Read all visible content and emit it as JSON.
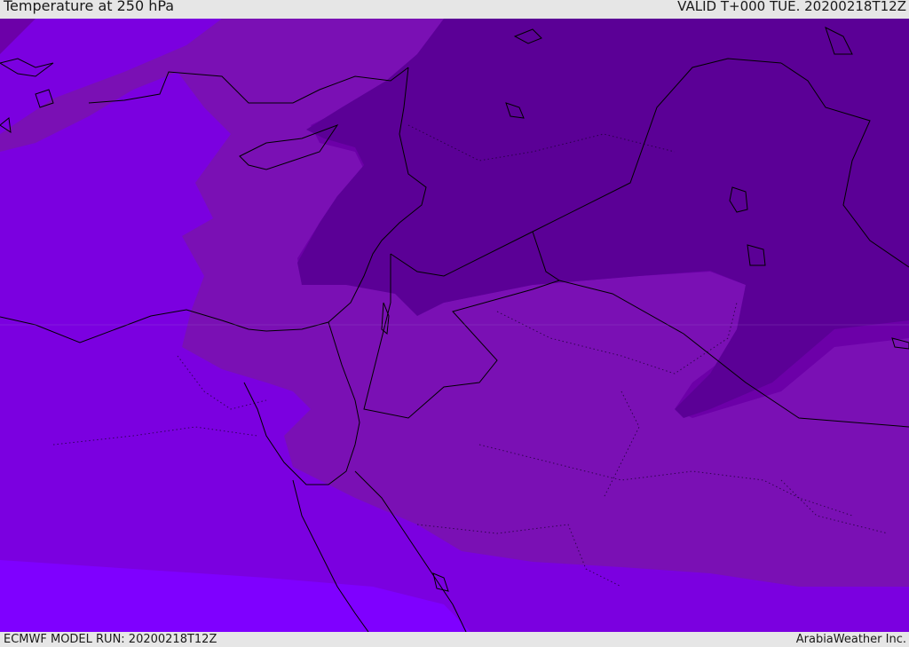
{
  "header": {
    "title": "Temperature at 250 hPa",
    "valid": "VALID T+000 TUE. 20200218T12Z"
  },
  "footer": {
    "model_run": "ECMWF MODEL RUN: 20200218T12Z",
    "credit": "ArabiaWeather Inc."
  },
  "map": {
    "colors": {
      "band_coldest": "#5b0096",
      "band_cold": "#6c00a8",
      "band_mid": "#7a10b4",
      "band_warm": "#7b00e0",
      "band_warmest": "#7f00ff",
      "coast": "#000000"
    }
  }
}
